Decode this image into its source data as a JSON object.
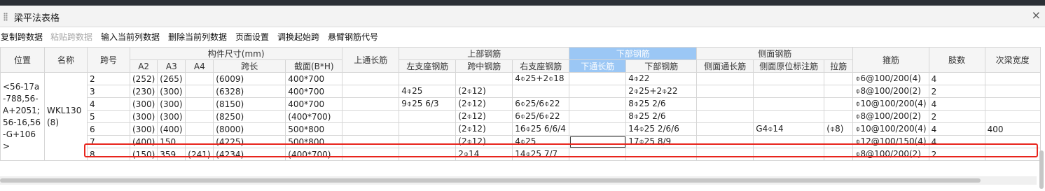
{
  "window": {
    "title": "梁平法表格"
  },
  "toolbar": [
    {
      "label": "复制跨数据",
      "disabled": false
    },
    {
      "label": "粘贴跨数据",
      "disabled": true
    },
    {
      "label": "输入当前列数据",
      "disabled": false
    },
    {
      "label": "删除当前列数据",
      "disabled": false
    },
    {
      "label": "页面设置",
      "disabled": false
    },
    {
      "label": "调换起始跨",
      "disabled": false
    },
    {
      "label": "悬臂钢筋代号",
      "disabled": false
    }
  ],
  "headers": {
    "position": "位置",
    "name": "名称",
    "span": "跨号",
    "component_size": "构件尺寸(mm)",
    "a2": "A2",
    "a3": "A3",
    "a4": "A4",
    "span_len": "跨长",
    "section": "截面(B*H)",
    "top_through": "上通长筋",
    "top_rebar": "上部钢筋",
    "left_support": "左支座钢筋",
    "mid_span": "跨中钢筋",
    "right_support": "右支座钢筋",
    "bottom_rebar": "下部钢筋",
    "bottom_through": "下通长筋",
    "bottom_rebar_sub": "下部钢筋",
    "side_rebar": "侧面钢筋",
    "side_through": "侧面通长筋",
    "side_original": "侧面原位标注筋",
    "tie": "拉筋",
    "stirrup": "箍筋",
    "legs": "肢数",
    "secondary_width": "次梁宽度"
  },
  "group": {
    "position": "<56-17a-788,56-A+2051;56-16,56-G+106>",
    "name": "WKL130(8)"
  },
  "rows": [
    {
      "span": "2",
      "a2": "(252)",
      "a3": "(265)",
      "a4": "",
      "span_len": "(6009)",
      "section": "400*700",
      "top_through": "",
      "left": "",
      "mid": "",
      "right": "4⌽25+2⌽18",
      "bot_through": "",
      "bottom": "4⌽22",
      "side_through": "",
      "side_orig": "",
      "tie": "",
      "stirrup": "⌽6@100/200(4)",
      "legs": "4",
      "sec_width": ""
    },
    {
      "span": "3",
      "a2": "(230)",
      "a3": "(300)",
      "a4": "",
      "span_len": "(6328)",
      "section": "400*700",
      "top_through": "",
      "left": "4⌽25",
      "mid": "(2⌽12)",
      "right": "",
      "bot_through": "",
      "bottom": "2⌽25+2⌽22",
      "side_through": "",
      "side_orig": "",
      "tie": "",
      "stirrup": "⌽8@100/200(2)",
      "legs": "2",
      "sec_width": ""
    },
    {
      "span": "4",
      "a2": "(300)",
      "a3": "(300)",
      "a4": "",
      "span_len": "(8150)",
      "section": "400*700",
      "top_through": "",
      "left": "9⌽25 6/3",
      "mid": "(2⌽12)",
      "right": "6⌽25/6⌽22",
      "bot_through": "",
      "bottom": "8⌽25 2/6",
      "side_through": "",
      "side_orig": "",
      "tie": "",
      "stirrup": "⌽10@100/200(4)",
      "legs": "4",
      "sec_width": ""
    },
    {
      "span": "5",
      "a2": "(300)",
      "a3": "(300)",
      "a4": "",
      "span_len": "(8250)",
      "section": "(400*700)",
      "top_through": "",
      "left": "",
      "mid": "(2⌽12)",
      "right": "6⌽25/6⌽22",
      "bot_through": "",
      "bottom": "8⌽25 2/6",
      "side_through": "",
      "side_orig": "",
      "tie": "",
      "stirrup": "⌽8@100/200(2)",
      "legs": "2",
      "sec_width": ""
    },
    {
      "span": "6",
      "a2": "(300)",
      "a3": "(400)",
      "a4": "",
      "span_len": "(8000)",
      "section": "500*800",
      "top_through": "",
      "left": "",
      "mid": "(2⌽12)",
      "right": "16⌽25 6/6/4",
      "bot_through": "",
      "bottom": "14⌽25 2/6/6",
      "side_through": "",
      "side_orig": "G4⌽14",
      "tie": "(⌽8)",
      "stirrup": "⌽10@100/200(4)",
      "legs": "4",
      "sec_width": "400"
    },
    {
      "span": "7",
      "a2": "(400)",
      "a3": "150",
      "a4": "",
      "span_len": "(4225)",
      "section": "500*800",
      "top_through": "",
      "left": "",
      "mid": "(2⌽12)",
      "right": "4⌽25",
      "bot_through": "",
      "bottom": "17⌽25 8/9",
      "side_through": "",
      "side_orig": "",
      "tie": "",
      "stirrup": "⌽12@100/150(4)",
      "legs": "4",
      "sec_width": ""
    },
    {
      "span": "8",
      "a2": "(150)",
      "a3": "359",
      "a4": "(241)",
      "span_len": "(4234)",
      "section": "(400*700)",
      "top_through": "",
      "left": "",
      "mid": "2⌽14",
      "right": "14⌽25 7/7",
      "bot_through": "",
      "bottom": "",
      "side_through": "",
      "side_orig": "",
      "tie": "",
      "stirrup": "⌽8@100/200(2)",
      "legs": "2",
      "sec_width": ""
    }
  ],
  "state": {
    "highlighted_row_span": "7",
    "selected_column": "下通长筋"
  },
  "colors": {
    "selected_header": "#9bc7f5",
    "highlight_box": "#e8251d"
  }
}
